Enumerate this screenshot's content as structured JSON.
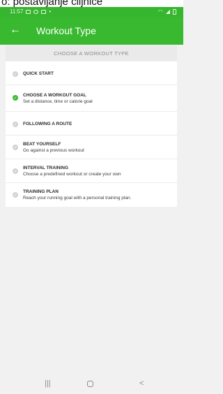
{
  "caption": {
    "text": "o: postavljanje ciljnice"
  },
  "status_bar": {
    "time": "11:57",
    "left_icons": [
      "gallery-icon",
      "whatsapp-icon",
      "mail-icon",
      "dot-icon"
    ],
    "right_icons": [
      "wifi-icon",
      "signal-icon",
      "battery-icon"
    ]
  },
  "app_bar": {
    "title": "Workout Type",
    "back_icon": "arrow-left-icon"
  },
  "section": {
    "header": "CHOOSE A WORKOUT TYPE"
  },
  "options": [
    {
      "title": "QUICK START",
      "desc": "",
      "selected": false
    },
    {
      "title": "CHOOSE A WORKOUT GOAL",
      "desc": "Set a distance, time or calorie goal",
      "selected": true
    },
    {
      "title": "FOLLOWING A ROUTE",
      "desc": "",
      "selected": false
    },
    {
      "title": "BEAT YOURSELF",
      "desc": "Go against a previous workout",
      "selected": false
    },
    {
      "title": "INTERVAL TRAINING",
      "desc": "Choose a predefined workout or create your own",
      "selected": false
    },
    {
      "title": "TRAINING PLAN",
      "desc": "Reach your running goal with a personal training plan.",
      "selected": false
    }
  ],
  "nav_bar": {
    "recents": "|||",
    "back": "<"
  },
  "colors": {
    "accent": "#39b930",
    "selected_check": "#3cb833",
    "unselected": "#d3d3d3"
  }
}
